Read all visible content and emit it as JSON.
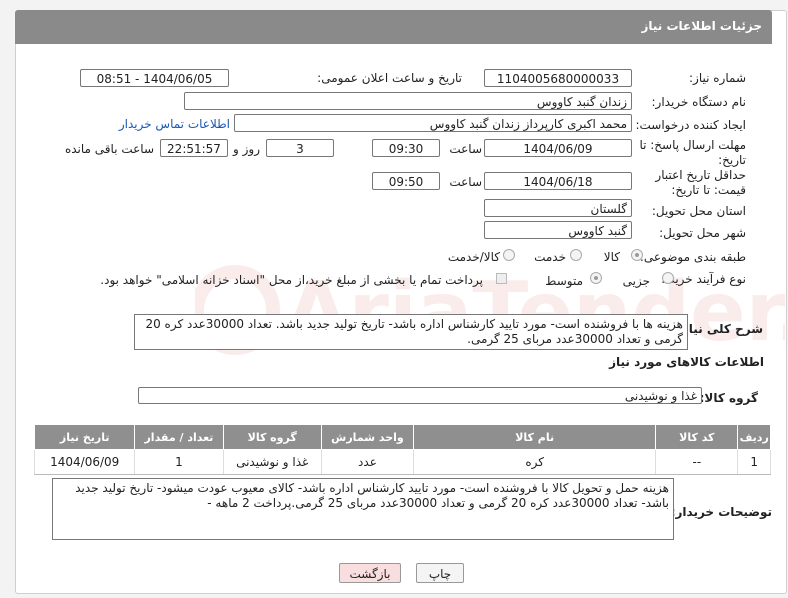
{
  "header": {
    "title": "جزئیات اطلاعات نیاز"
  },
  "form": {
    "need_number_label": "شماره نیاز:",
    "need_number": "1104005680000033",
    "announce_label": "تاریخ و ساعت اعلان عمومی:",
    "announce_value": "1404/06/05 - 08:51",
    "buyer_org_label": "نام دستگاه خریدار:",
    "buyer_org": "زندان گنبد کاووس",
    "creator_label": "ایجاد کننده درخواست:",
    "creator": "محمد اکبری کارپرداز زندان گنبد کاووس",
    "contact_link": "اطلاعات تماس خریدار",
    "reply_deadline_label": "مهلت ارسال پاسخ: تا تاریخ:",
    "reply_date": "1404/06/09",
    "time_label": "ساعت",
    "reply_time": "09:30",
    "days_value": "3",
    "days_label": "روز و",
    "remaining_time": "22:51:57",
    "remaining_label": "ساعت باقی مانده",
    "price_deadline_label": "حداقل تاریخ اعتبار قیمت: تا تاریخ:",
    "price_date": "1404/06/18",
    "price_time": "09:50",
    "province_label": "استان محل تحویل:",
    "province": "گلستان",
    "city_label": "شهر محل تحویل:",
    "city": "گنبد کاووس",
    "category_label": "طبقه بندی موضوعی:",
    "category_options": [
      "کالا",
      "خدمت",
      "کالا/خدمت"
    ],
    "category_selected": "کالا",
    "process_label": "نوع فرآیند خرید :",
    "process_options": [
      "جزیی",
      "متوسط"
    ],
    "process_selected": "متوسط",
    "payment_note": "پرداخت تمام یا بخشی از مبلغ خرید،از محل \"اسناد خزانه اسلامی\" خواهد بود."
  },
  "description": {
    "label": "شرح کلی نیاز:",
    "text": "هزینه ها با فروشنده است- مورد تایید کارشناس اداره باشد- تاریخ تولید جدید باشد. تعداد 30000عدد کره 20 گرمی و تعداد 30000عدد مربای 25 گرمی."
  },
  "goods": {
    "section_title": "اطلاعات کالاهای مورد نیاز",
    "group_label": "گروه کالا:",
    "group_value": "غذا و نوشیدنی",
    "columns": [
      "ردیف",
      "کد کالا",
      "نام کالا",
      "واحد شمارش",
      "گروه کالا",
      "تعداد / مقدار",
      "تاریخ نیاز"
    ],
    "rows": [
      [
        "1",
        "--",
        "کره",
        "عدد",
        "غذا و نوشیدنی",
        "1",
        "1404/06/09"
      ]
    ]
  },
  "buyer_notes": {
    "label": "توضیحات خریدار:",
    "text": "هزینه حمل و تحویل کالا با فروشنده است- مورد تایید کارشناس اداره باشد- کالای معیوب عودت میشود- تاریخ تولید جدید باشد- تعداد 30000عدد کره 20 گرمی و تعداد 30000عدد مربای 25 گرمی.پرداخت 2 ماهه -"
  },
  "buttons": {
    "print": "چاپ",
    "back": "بازگشت"
  },
  "watermark": {
    "text": "AriaTender.neT"
  },
  "colors": {
    "header_bg": "#8a8a8a",
    "link": "#1a58b5",
    "back_button_bg": "#f8dede",
    "watermark": "#c0392b"
  }
}
